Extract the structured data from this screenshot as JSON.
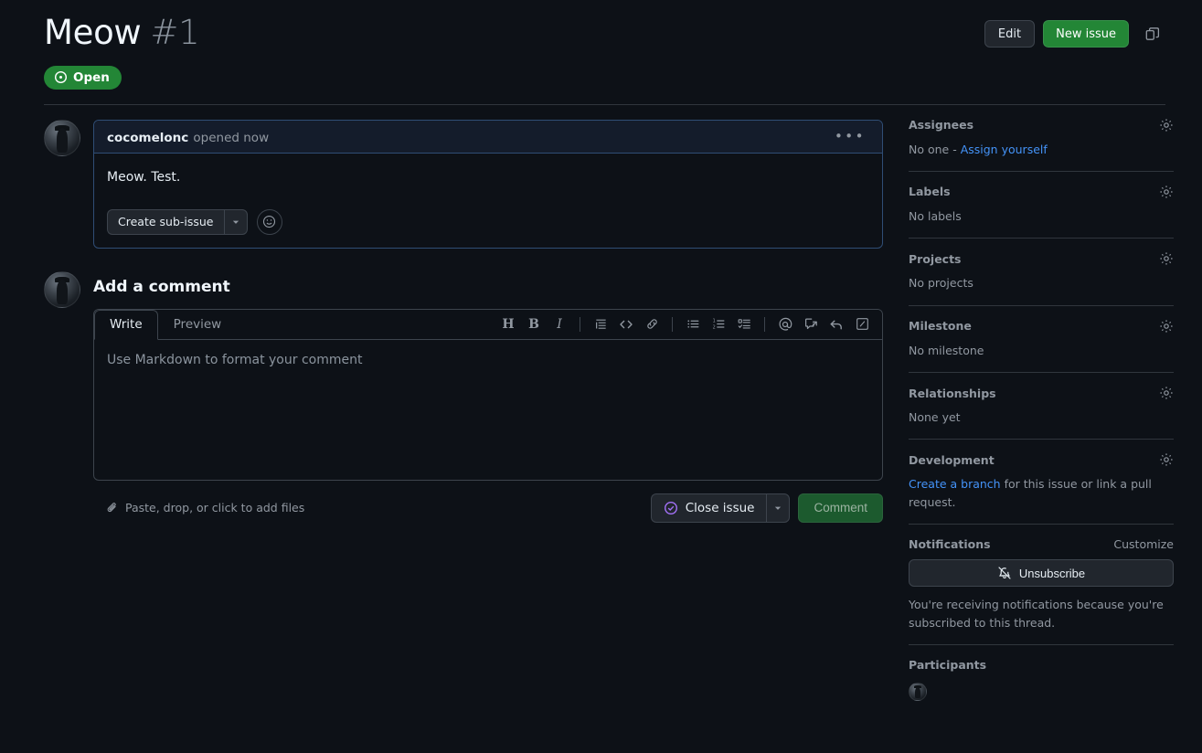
{
  "header": {
    "title": "Meow",
    "number": "#1",
    "edit_label": "Edit",
    "new_issue_label": "New issue",
    "copy_icon": "copy-icon",
    "state_label": "Open",
    "state_icon": "issue-opened-icon",
    "state_color": "#238636"
  },
  "comment": {
    "author": "cocomelonc",
    "meta": "opened now",
    "body": "Meow. Test.",
    "sub_issue_label": "Create sub-issue",
    "caret_icon": "chevron-down-icon",
    "emoji_icon": "smiley-icon",
    "kebab_icon": "kebab-horizontal-icon"
  },
  "add_comment": {
    "heading": "Add a comment",
    "tabs": [
      {
        "label": "Write",
        "active": true
      },
      {
        "label": "Preview",
        "active": false
      }
    ],
    "placeholder": "Use Markdown to format your comment",
    "toolbar": [
      {
        "name": "heading-icon",
        "label": "H"
      },
      {
        "name": "bold-icon",
        "label": "B"
      },
      {
        "name": "italic-icon",
        "label": "I"
      },
      {
        "name": "quote-icon",
        "label": ""
      },
      {
        "name": "code-icon",
        "label": ""
      },
      {
        "name": "link-icon",
        "label": ""
      },
      {
        "name": "unordered-list-icon",
        "label": ""
      },
      {
        "name": "ordered-list-icon",
        "label": ""
      },
      {
        "name": "task-list-icon",
        "label": ""
      },
      {
        "name": "mention-icon",
        "label": ""
      },
      {
        "name": "cross-reference-icon",
        "label": ""
      },
      {
        "name": "reply-icon",
        "label": ""
      },
      {
        "name": "slash-command-icon",
        "label": ""
      }
    ],
    "attach_text": "Paste, drop, or click to add files",
    "attach_icon": "paperclip-icon",
    "close_issue_label": "Close issue",
    "close_issue_icon": "issue-closed-icon",
    "close_issue_icon_color": "#a371f7",
    "close_caret_icon": "chevron-down-icon",
    "comment_button_label": "Comment"
  },
  "sidebar": {
    "sections": [
      {
        "title": "Assignees",
        "gear": "gear-icon",
        "text_prefix": "No one - ",
        "link": "Assign yourself",
        "text_suffix": ""
      },
      {
        "title": "Labels",
        "gear": "gear-icon",
        "text_prefix": "No labels",
        "link": "",
        "text_suffix": ""
      },
      {
        "title": "Projects",
        "gear": "gear-icon",
        "text_prefix": "No projects",
        "link": "",
        "text_suffix": ""
      },
      {
        "title": "Milestone",
        "gear": "gear-icon",
        "text_prefix": "No milestone",
        "link": "",
        "text_suffix": ""
      },
      {
        "title": "Relationships",
        "gear": "gear-icon",
        "text_prefix": "None yet",
        "link": "",
        "text_suffix": ""
      },
      {
        "title": "Development",
        "gear": "gear-icon",
        "text_prefix": "",
        "link": "Create a branch",
        "text_suffix": " for this issue or link a pull request."
      }
    ],
    "notifications": {
      "title": "Notifications",
      "customize_label": "Customize",
      "button_label": "Unsubscribe",
      "button_icon": "bell-slash-icon",
      "description": "You're receiving notifications because you're subscribed to this thread."
    },
    "participants": {
      "title": "Participants",
      "avatars": [
        "cocomelonc"
      ]
    }
  }
}
